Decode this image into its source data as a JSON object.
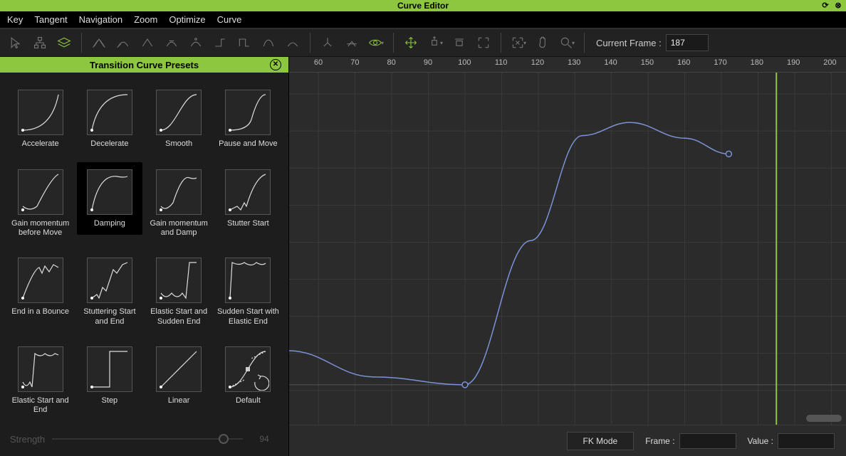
{
  "window": {
    "title": "Curve Editor"
  },
  "menus": [
    "Key",
    "Tangent",
    "Navigation",
    "Zoom",
    "Optimize",
    "Curve"
  ],
  "toolbar": {
    "current_frame_label": "Current Frame :",
    "current_frame_value": "187"
  },
  "presets_panel": {
    "title": "Transition Curve Presets",
    "selected": "Damping",
    "items": [
      {
        "id": "accelerate",
        "label": "Accelerate"
      },
      {
        "id": "decelerate",
        "label": "Decelerate"
      },
      {
        "id": "smooth",
        "label": "Smooth"
      },
      {
        "id": "pause-and-move",
        "label": "Pause and Move"
      },
      {
        "id": "gain-momentum",
        "label": "Gain momentum before Move"
      },
      {
        "id": "damping",
        "label": "Damping"
      },
      {
        "id": "gain-and-damp",
        "label": "Gain momentum and Damp"
      },
      {
        "id": "stutter-start",
        "label": "Stutter Start"
      },
      {
        "id": "end-bounce",
        "label": "End in a Bounce"
      },
      {
        "id": "stutter-both",
        "label": "Stuttering Start and End"
      },
      {
        "id": "elastic-sudden",
        "label": "Elastic Start and Sudden End"
      },
      {
        "id": "sudden-elastic",
        "label": "Sudden Start with Elastic End"
      },
      {
        "id": "elastic-both",
        "label": "Elastic Start and End"
      },
      {
        "id": "step",
        "label": "Step"
      },
      {
        "id": "linear",
        "label": "Linear"
      },
      {
        "id": "default",
        "label": "Default"
      }
    ],
    "strength_label": "Strength",
    "strength_value": "94"
  },
  "graph": {
    "ruler_ticks": [
      "60",
      "70",
      "80",
      "90",
      "100",
      "110",
      "120",
      "130",
      "140",
      "150",
      "160",
      "170",
      "180",
      "190",
      "200"
    ],
    "ruler_tick_frames": [
      60,
      70,
      80,
      90,
      100,
      110,
      120,
      130,
      140,
      150,
      160,
      170,
      180,
      190,
      200
    ],
    "frame_start": 52,
    "frame_end": 204,
    "playhead_frame": 185
  },
  "status": {
    "fk_mode": "FK Mode",
    "frame_label": "Frame :",
    "frame_value": "",
    "value_label": "Value :",
    "value_value": ""
  },
  "chart_data": {
    "type": "line",
    "xlabel": "Frame",
    "ylabel": "",
    "series": [
      {
        "name": "curve",
        "points": [
          {
            "frame": 52,
            "y_norm": 0.13
          },
          {
            "frame": 75,
            "y_norm": 0.03
          },
          {
            "frame": 100,
            "y_norm": 0.0
          },
          {
            "frame": 118,
            "y_norm": 0.55
          },
          {
            "frame": 132,
            "y_norm": 0.95
          },
          {
            "frame": 145,
            "y_norm": 1.0
          },
          {
            "frame": 160,
            "y_norm": 0.94
          },
          {
            "frame": 172,
            "y_norm": 0.88
          }
        ]
      }
    ],
    "keyframes": [
      {
        "frame": 100,
        "y_norm": 0.0
      },
      {
        "frame": 172,
        "y_norm": 0.88
      }
    ]
  }
}
